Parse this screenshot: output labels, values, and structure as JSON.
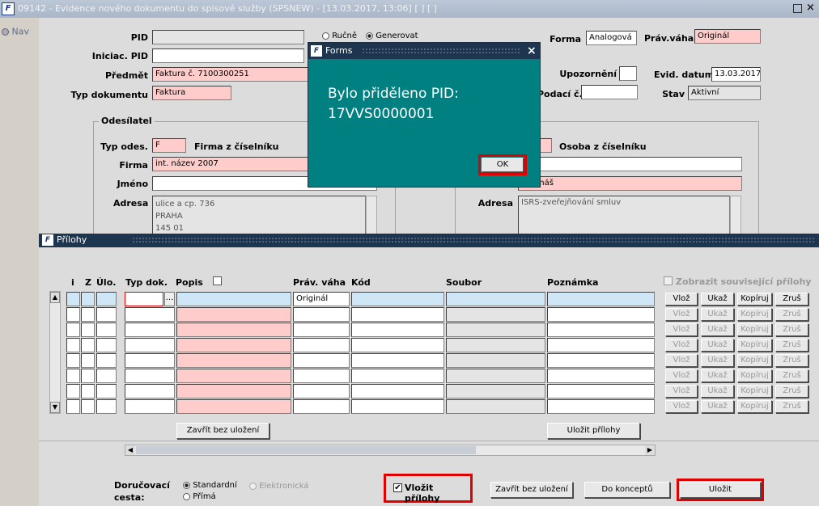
{
  "window": {
    "title": "09142 - Evidence nového dokumentu do spisové služby (SPSNEW) - [13.03.2017, 13:06]  [ ]  [ ]",
    "nav_label": "Nav"
  },
  "form": {
    "pid_label": "PID",
    "mode_manual": "Ručně",
    "mode_generate": "Generovat",
    "iniciac_pid_label": "Iniciac. PID",
    "predmet_label": "Předmět",
    "predmet_value": "Faktura č. 7100300251",
    "typ_dokumentu_label": "Typ dokumentu",
    "typ_dokumentu_value": "Faktura",
    "forma_label": "Forma",
    "forma_value": "Analogová",
    "prav_vaha_label": "Práv.váha",
    "prav_vaha_value": "Originál",
    "upozorneni_label": "Upozornění",
    "evid_datum_label": "Evid. datum",
    "evid_datum_value": "13.03.2017",
    "podaci_label": "Podací č.",
    "stav_label": "Stav",
    "stav_value": "Aktivní"
  },
  "sender": {
    "section_title": "Odesílatel",
    "typ_odes_label": "Typ odes.",
    "typ_odes_value": "F",
    "firma_ciselnik_label": "Firma z číselníku",
    "firma_label": "Firma",
    "firma_value": "int. název 2007",
    "jmeno_label": "Jméno",
    "adresa_label": "Adresa",
    "adresa_lines": [
      "ulice a cp. 736",
      "PRAHA",
      "145 01"
    ],
    "osoba_ciselnik_label": "Osoba z číselníku",
    "osoba_value": "s Tomáš",
    "adresa2_label": "Adresa",
    "adresa2_value": "ISRS-zveřejňování smluv"
  },
  "dialog": {
    "title": "Forms",
    "line1": "Bylo přiděleno PID:",
    "line2": "17VVS0000001",
    "ok_label": "OK",
    "close_glyph": "×"
  },
  "attachments": {
    "title": "Přílohy",
    "columns": {
      "i": "i",
      "z": "Z",
      "ulo": "Úlo.",
      "typ_dok": "Typ dok.",
      "popis": "Popis",
      "prav_vaha": "Práv. váha",
      "kod": "Kód",
      "soubor": "Soubor",
      "poznamka": "Poznámka"
    },
    "show_related_label": "Zobrazit související přílohy",
    "first_row_prav_vaha": "Originál",
    "row_buttons": [
      "Vlož",
      "Ukaž",
      "Kopíruj",
      "Zruš"
    ],
    "close_without_save_label": "Zavřít bez uložení",
    "save_attachments_label": "Uložit přílohy"
  },
  "footer": {
    "delivery_label_1": "Doručovací",
    "delivery_label_2": "cesta:",
    "opt_standard": "Standardní",
    "opt_electronic": "Elektronická",
    "opt_direct": "Přímá",
    "insert_attachments_label": "Vložit přílohy",
    "close_without_save_label": "Zavřít bez uložení",
    "to_drafts_label": "Do konceptů",
    "save_label": "Uložit"
  }
}
